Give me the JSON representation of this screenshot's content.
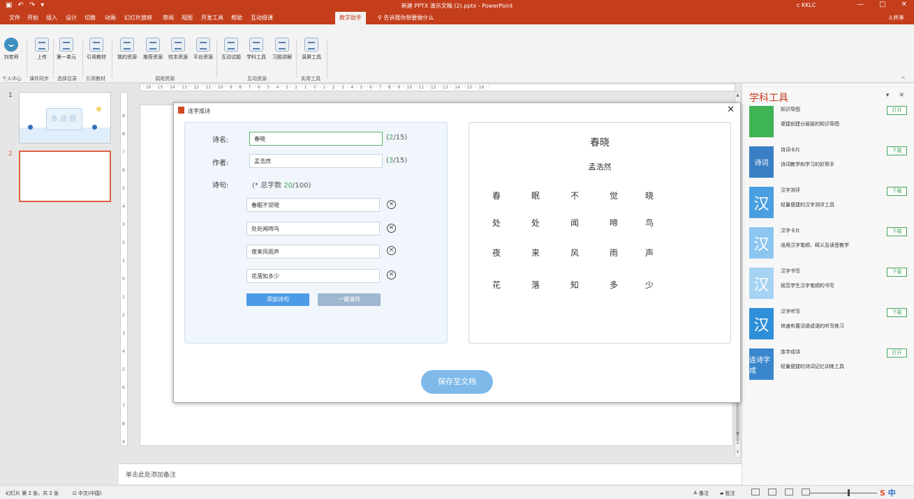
{
  "titlebar": {
    "qa_icons": [
      "save-icon",
      "undo-icon",
      "redo-icon",
      "customize-icon"
    ],
    "title": "新建 PPTX 演示文稿 (2).pptx - PowerPoint",
    "user": "c KKLC",
    "win_buttons": [
      "—",
      "□",
      "✕"
    ]
  },
  "menu": {
    "tabs": [
      "文件",
      "开始",
      "插入",
      "设计",
      "切换",
      "动画",
      "幻灯片放映",
      "审阅",
      "视图",
      "开发工具",
      "帮助",
      "互动授课",
      "教学助手"
    ],
    "active_tab": "教学助手",
    "search": "告诉我你想要做什么",
    "share": "共享"
  },
  "ribbon": {
    "buttons": [
      {
        "label": "刘老师",
        "icon": "user-avatar-icon"
      },
      {
        "label": "上传",
        "icon": "cloud-upload-icon"
      },
      {
        "label": "第一单元",
        "icon": "unit-icon"
      },
      {
        "label": "引用教材",
        "icon": "textbook-icon"
      },
      {
        "label": "我的资源",
        "icon": "my-resources-icon"
      },
      {
        "label": "推荐资源",
        "icon": "recommended-icon"
      },
      {
        "label": "校本资源",
        "icon": "school-icon"
      },
      {
        "label": "平台资源",
        "icon": "platform-icon"
      },
      {
        "label": "互动试题",
        "icon": "quiz-icon"
      },
      {
        "label": "学科工具",
        "icon": "subject-tools-icon"
      },
      {
        "label": "习题讲解",
        "icon": "exercise-icon"
      },
      {
        "label": "录屏工具",
        "icon": "screen-record-icon"
      }
    ],
    "groups": [
      "个人中心",
      "课件同步",
      "选择目录",
      "引用教材",
      "调用资源",
      "互动资源",
      "实用工具"
    ]
  },
  "slides": {
    "thumb1_title": "多 选 题",
    "numbers": [
      "1",
      "2"
    ]
  },
  "ruler_text": "· · 16 · · 15 · · 14 · · 13 · · 12 · · 11 · · 10 · · 9 · · 8 · · 7 · · 6 · · 5 · · 4 · · 3 · · 2 · · 1 · · 0 · · 1 · · 2 · · 3 · · 4 · · 5 · · 6 · · 7 · · 8 · · 9 · · 10 · · 11 · · 12 · · 13 · · 14 · · 15 · · 16 · ·",
  "vruler_ticks": [
    "9",
    "8",
    "7",
    "6",
    "5",
    "4",
    "3",
    "2",
    "1",
    "0",
    "1",
    "2",
    "3",
    "4",
    "5",
    "6",
    "7",
    "8",
    "9"
  ],
  "notes_placeholder": "单击此处添加备注",
  "dialog": {
    "title": "连字成诗",
    "close": "✕",
    "poem_label": "诗名:",
    "poem_value": "春晓",
    "poem_count": {
      "current": "2",
      "max": "/15)"
    },
    "author_label": "作者:",
    "author_value": "孟浩然",
    "author_count": {
      "current": "3",
      "max": "/15)"
    },
    "lines_label": "诗句:",
    "total": {
      "prefix": "(* 总字数 ",
      "current": "20",
      "suffix": "/100)"
    },
    "lines": [
      "春眠不觉晓",
      "处处闻啼鸟",
      "夜来风雨声",
      "花落知多少"
    ],
    "add_label": "添加诗句",
    "clear_label": "一键清除",
    "save_label": "保存至文档",
    "preview": {
      "title": "春晓",
      "author": "孟浩然",
      "rows": [
        [
          "春",
          "眠",
          "不",
          "觉",
          "晓"
        ],
        [
          "处",
          "处",
          "闻",
          "啼",
          "鸟"
        ],
        [
          "夜",
          "来",
          "风",
          "雨",
          "声"
        ],
        [
          "花",
          "落",
          "知",
          "多",
          "少"
        ]
      ]
    }
  },
  "taskpane": {
    "title": "学科工具",
    "tools": [
      {
        "name": "知识导图",
        "desc": "便捷创建分层级的知识导图",
        "button": "打开",
        "icon_text": "",
        "color": "#3fb455",
        "icon": "mindmap-icon"
      },
      {
        "name": "诗词卡片",
        "desc": "诗词教学和学习的好帮手",
        "button": "下载",
        "icon_text": "诗词",
        "color": "#3a7fc4",
        "icon": "poem-card-icon"
      },
      {
        "name": "汉字测评",
        "desc": "轻量便捷的汉字测评工具",
        "button": "下载",
        "icon_text": "汉",
        "color": "#4a9fe0",
        "icon": "hanzi-test-icon"
      },
      {
        "name": "汉字卡片",
        "desc": "适用汉字笔顺、释义及读音教学",
        "button": "下载",
        "icon_text": "汉",
        "color": "#8cc6f0",
        "icon": "hanzi-card-icon"
      },
      {
        "name": "汉字书写",
        "desc": "规范学生汉字笔顺的书写",
        "button": "下载",
        "icon_text": "汉",
        "color": "#a6d3f3",
        "icon": "hanzi-write-icon"
      },
      {
        "name": "汉字听写",
        "desc": "快速布置词语成语的听写练习",
        "button": "下载",
        "icon_text": "汉",
        "color": "#2f8fd8",
        "icon": "dictation-icon"
      },
      {
        "name": "连字成诗",
        "desc": "轻量便捷的诗词记忆训练工具",
        "button": "打开",
        "icon_text": "连诗字成",
        "color": "#3a86cc",
        "icon": "connect-poem-icon"
      }
    ]
  },
  "status": {
    "slide": "幻灯片 第 2 张，共 2 张",
    "lang": "中文(中国)",
    "notes": "≜ 备注",
    "comments": "批注",
    "ime": "中"
  }
}
